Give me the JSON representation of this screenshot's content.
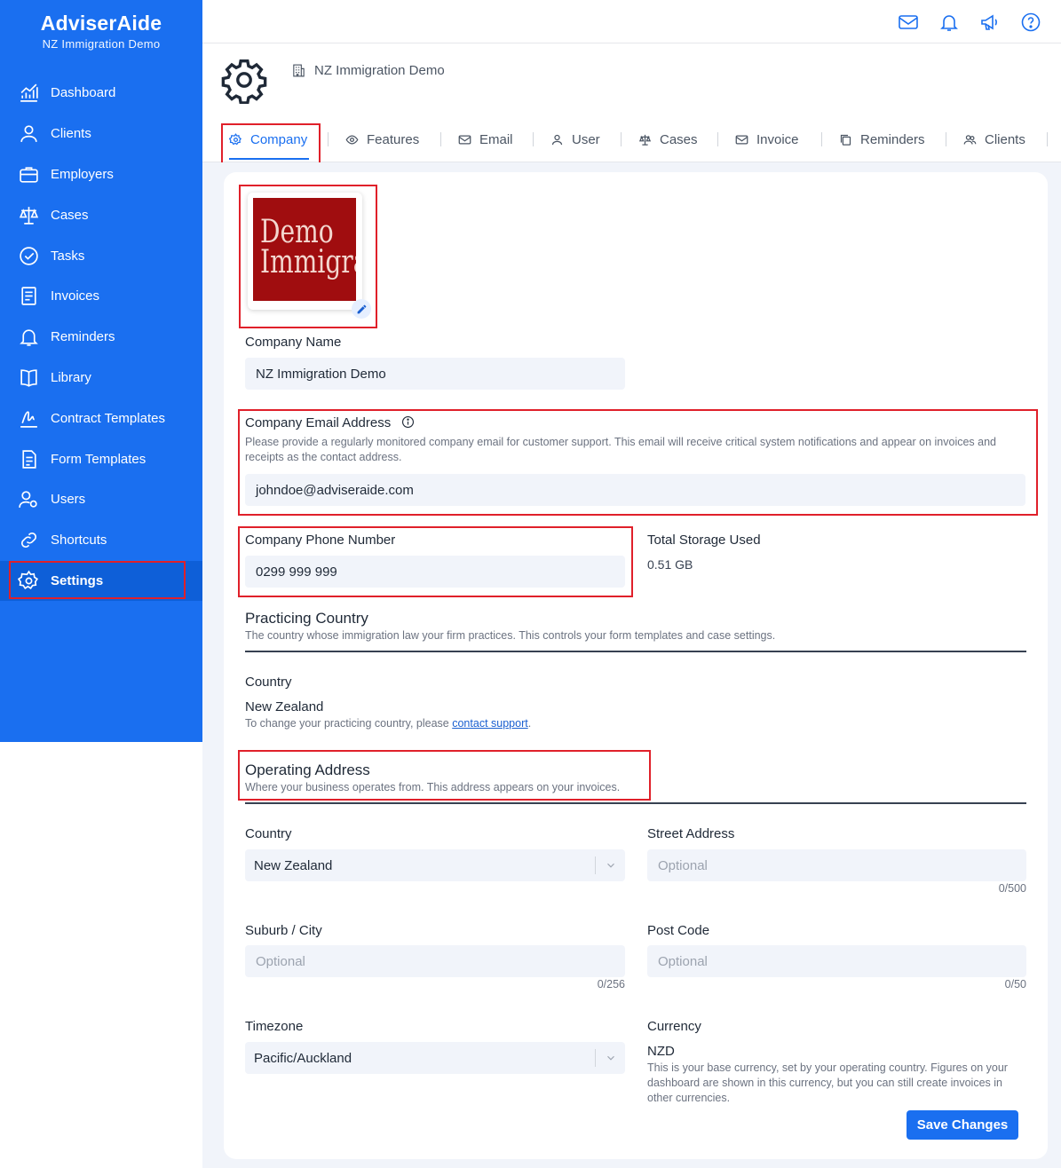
{
  "brand": {
    "title": "AdviserAide",
    "subtitle": "NZ Immigration Demo"
  },
  "sidebar": {
    "items": [
      {
        "label": "Dashboard",
        "icon": "chart-icon"
      },
      {
        "label": "Clients",
        "icon": "person-icon"
      },
      {
        "label": "Employers",
        "icon": "briefcase-icon"
      },
      {
        "label": "Cases",
        "icon": "scales-icon"
      },
      {
        "label": "Tasks",
        "icon": "check-circle-icon"
      },
      {
        "label": "Invoices",
        "icon": "invoice-icon"
      },
      {
        "label": "Reminders",
        "icon": "bell-icon"
      },
      {
        "label": "Library",
        "icon": "book-icon"
      },
      {
        "label": "Contract Templates",
        "icon": "signature-icon"
      },
      {
        "label": "Form Templates",
        "icon": "document-icon"
      },
      {
        "label": "Users",
        "icon": "users-icon"
      },
      {
        "label": "Shortcuts",
        "icon": "link-icon"
      },
      {
        "label": "Settings",
        "icon": "gear-icon",
        "active": true
      }
    ]
  },
  "topbar": {
    "icons": [
      "mail-icon",
      "bell-icon",
      "megaphone-icon",
      "help-icon"
    ]
  },
  "header": {
    "org_name": "NZ Immigration Demo"
  },
  "tabs": [
    {
      "label": "Company",
      "active": true
    },
    {
      "label": "Features"
    },
    {
      "label": "Email"
    },
    {
      "label": "User"
    },
    {
      "label": "Cases"
    },
    {
      "label": "Invoice"
    },
    {
      "label": "Reminders"
    },
    {
      "label": "Clients"
    }
  ],
  "company": {
    "logo_text_line1": "Demo",
    "logo_text_line2": "Immigrat",
    "name_label": "Company Name",
    "name_value": "NZ Immigration Demo",
    "email_label": "Company Email Address",
    "email_help": "Please provide a regularly monitored company email for customer support. This email will receive critical system notifications and appear on invoices and receipts as the contact address.",
    "email_value": "johndoe@adviseraide.com",
    "phone_label": "Company Phone Number",
    "phone_value": "0299 999 999",
    "storage_label": "Total Storage Used",
    "storage_value": "0.51 GB"
  },
  "practicing": {
    "title": "Practicing Country",
    "help": "The country whose immigration law your firm practices. This controls your form templates and case settings.",
    "country_label": "Country",
    "country_value": "New Zealand",
    "change_text": "To change your practicing country, please ",
    "change_link": "contact support",
    "change_end": "."
  },
  "address": {
    "title": "Operating Address",
    "help": "Where your business operates from. This address appears on your invoices.",
    "country_label": "Country",
    "country_value": "New Zealand",
    "street_label": "Street Address",
    "street_placeholder": "Optional",
    "street_counter": "0/500",
    "suburb_label": "Suburb / City",
    "suburb_placeholder": "Optional",
    "suburb_counter": "0/256",
    "postcode_label": "Post Code",
    "postcode_placeholder": "Optional",
    "postcode_counter": "0/50",
    "timezone_label": "Timezone",
    "timezone_value": "Pacific/Auckland",
    "currency_label": "Currency",
    "currency_value": "NZD",
    "currency_help": "This is your base currency, set by your operating country. Figures on your dashboard are shown in this currency, but you can still create invoices in other currencies."
  },
  "actions": {
    "save_label": "Save Changes"
  },
  "colors": {
    "primary": "#1a6ff0",
    "highlight": "#e0202a",
    "logo_bg": "#a00d0f"
  }
}
